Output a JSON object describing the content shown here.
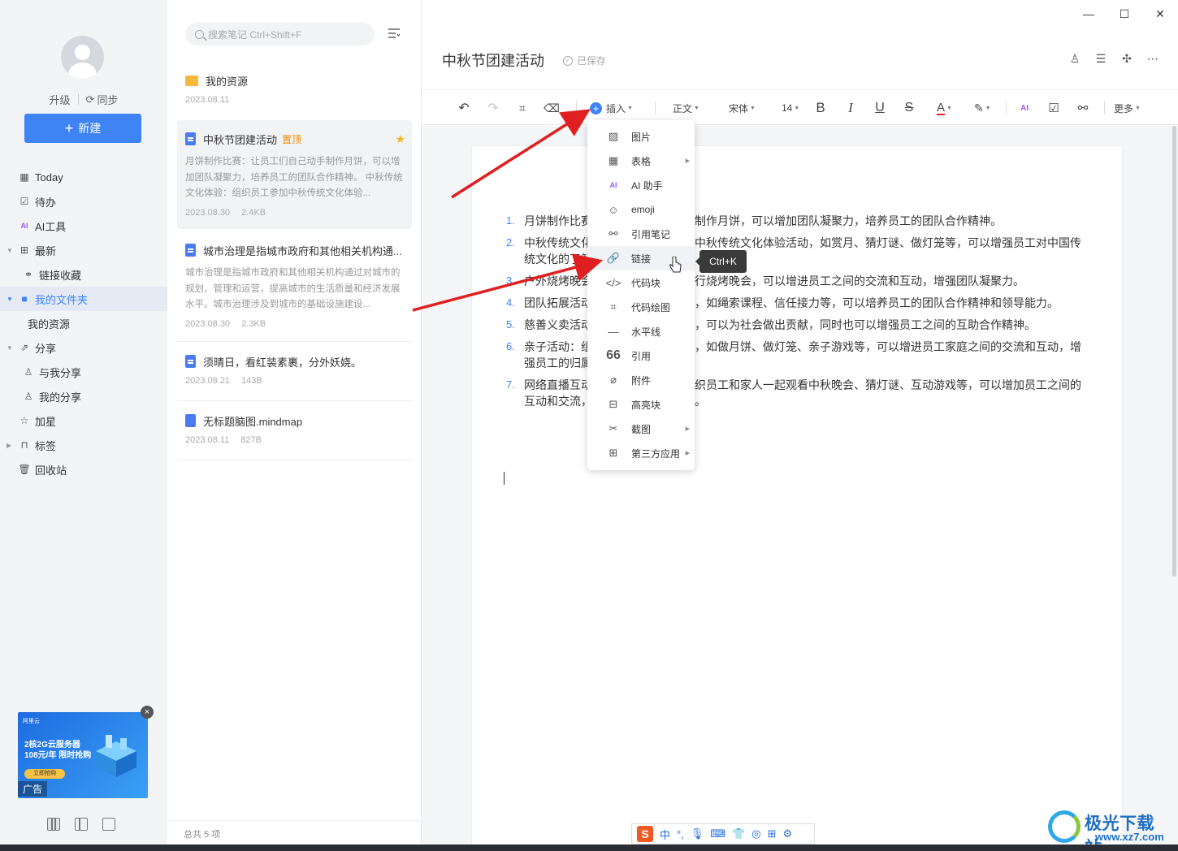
{
  "sidebar": {
    "upgrade": "升级",
    "sync": "同步",
    "new_button": "新建",
    "nav": {
      "today": "Today",
      "todo": "待办",
      "ai_tools": "AI工具",
      "recent": "最新",
      "link_favorites": "链接收藏",
      "my_folder": "我的文件夹",
      "my_resources": "我的资源",
      "share": "分享",
      "shared_with_me": "与我分享",
      "my_shares": "我的分享",
      "starred": "加星",
      "tags": "标签",
      "trash": "回收站"
    },
    "ad": {
      "brand": "阿里云",
      "line1": "2核2G云服务器",
      "line2": "108元/年 限时抢购",
      "cta": "立即抢购",
      "tag": "广告"
    }
  },
  "list": {
    "search_placeholder": "搜索笔记 Ctrl+Shift+F",
    "notes": [
      {
        "title": "我的资源",
        "date": "2023.08.11"
      },
      {
        "title": "中秋节团建活动",
        "pin": "置顶",
        "snippet": "月饼制作比赛：让员工们自己动手制作月饼，可以增加团队凝聚力，培养员工的团队合作精神。 中秋传统文化体验：组织员工参加中秋传统文化体验...",
        "date": "2023.08.30",
        "size": "2.4KB"
      },
      {
        "title": "城市治理是指城市政府和其他相关机构通...",
        "snippet": "城市治理是指城市政府和其他相关机构通过对城市的规划、管理和运营，提高城市的生活质量和经济发展水平。城市治理涉及到城市的基础设施建设...",
        "date": "2023.08.30",
        "size": "2.3KB"
      },
      {
        "title": "须晴日，看红装素裹，分外妖娆。",
        "date": "2023.08.21",
        "size": "143B"
      },
      {
        "title": "无标题脑图.mindmap",
        "date": "2023.08.11",
        "size": "827B"
      }
    ],
    "footer": "总共 5 项"
  },
  "editor": {
    "title": "中秋节团建活动",
    "saved": "已保存",
    "toolbar": {
      "insert": "插入",
      "paragraph": "正文",
      "font": "宋体",
      "size": "14",
      "bold": "B",
      "italic": "I",
      "underline": "U",
      "strike": "S",
      "font_color": "A",
      "more": "更多"
    },
    "items": [
      "月饼制作比赛：让员工们自己动手制作月饼，可以增加团队凝聚力，培养员工的团队合作精神。",
      "中秋传统文化体验：组织员工参加中秋传统文化体验活动，如赏月、猜灯谜、做灯笼等，可以增强员工对中国传统文化的了解。",
      "户外烧烤晚会：组织员工在户外进行烧烤晚会，可以增进员工之间的交流和互动，增强团队凝聚力。",
      "团队拓展活动：组织团队拓展活动，如绳索课程、信任接力等，可以培养员工的团队合作精神和领导能力。",
      "慈善义卖活动：组织慈善义卖活动，可以为社会做出贡献，同时也可以增强员工之间的互助合作精神。",
      "亲子活动：组织员工参加亲子活动，如做月饼、做灯笼、亲子游戏等，可以增进员工家庭之间的交流和互动，增强员工的归属感。",
      "网络直播互动：举办网络直播，组织员工和家人一起观看中秋晚会、猜灯谜、互动游戏等，可以增加员工之间的互动和交流，提升公司的品牌形象。"
    ]
  },
  "insert_menu": {
    "items": [
      {
        "label": "图片",
        "icon": "image-icon"
      },
      {
        "label": "表格",
        "icon": "table-icon"
      },
      {
        "label": "AI 助手",
        "icon": "ai-icon"
      },
      {
        "label": "emoji",
        "icon": "emoji-icon"
      },
      {
        "label": "引用笔记",
        "icon": "link-note-icon"
      },
      {
        "label": "链接",
        "icon": "link-icon"
      },
      {
        "label": "代码块",
        "icon": "code-icon"
      },
      {
        "label": "代码绘图",
        "icon": "diagram-icon"
      },
      {
        "label": "水平线",
        "icon": "hr-icon"
      },
      {
        "label": "引用",
        "icon": "quote-icon"
      },
      {
        "label": "附件",
        "icon": "attachment-icon"
      },
      {
        "label": "高亮块",
        "icon": "highlight-icon"
      },
      {
        "label": "截图",
        "icon": "screenshot-icon"
      },
      {
        "label": "第三方应用",
        "icon": "apps-icon"
      }
    ],
    "tooltip": "Ctrl+K"
  },
  "ime": {
    "lang": "中"
  },
  "watermark": {
    "title": "极光下载站",
    "url": "www.xz7.com"
  },
  "colors": {
    "accent": "#3f84f4",
    "arrow": "#e02020",
    "pin": "#f08c00"
  }
}
